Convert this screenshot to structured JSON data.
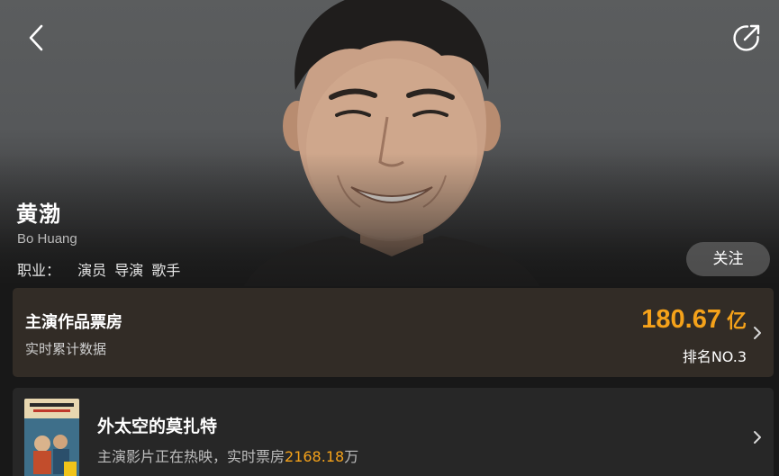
{
  "nav": {
    "back_icon": "chevron-left-icon",
    "share_icon": "share-icon"
  },
  "profile": {
    "name_cn": "黄渤",
    "name_en": "Bo Huang",
    "profession_label": "职业：",
    "professions": [
      "演员",
      "导演",
      "歌手"
    ],
    "follow_label": "关注"
  },
  "box_office": {
    "title": "主演作品票房",
    "subtitle": "实时累计数据",
    "value": "180.67",
    "unit": "亿",
    "rank": "排名NO.3",
    "value_color": "#f5a21a"
  },
  "now_showing": {
    "movie_title": "外太空的莫扎特",
    "status_prefix": "主演影片正在热映，实时票房",
    "box_office_value": "2168.18",
    "box_office_unit": "万"
  },
  "colors": {
    "accent": "#f5a21a",
    "card_bg": "#322c26",
    "page_bg": "#181818"
  }
}
